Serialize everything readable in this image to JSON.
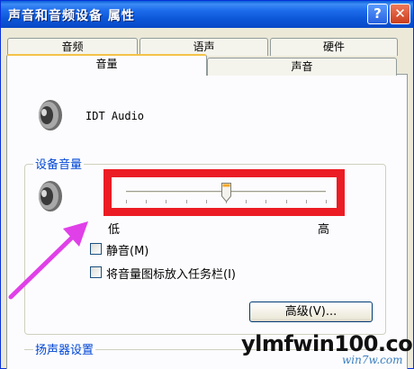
{
  "window": {
    "title": "声音和音频设备 属性",
    "help_label": "?",
    "close_label": "✕"
  },
  "tabs_back": [
    "音频",
    "语声",
    "硬件"
  ],
  "tabs_front": {
    "active": "音量",
    "other": "声音"
  },
  "device": {
    "name": "IDT Audio"
  },
  "volume_group": {
    "label": "设备音量",
    "low_label": "低",
    "high_label": "高",
    "level_fraction": 0.5
  },
  "options": {
    "mute_label": "静音(M)",
    "mute_checked": false,
    "tray_label": "将音量图标放入任务栏(I)",
    "tray_checked": false
  },
  "advanced_button": "高级(V)...",
  "speaker_group": {
    "label": "扬声器设置"
  },
  "watermark": {
    "main": "ylmfwin100.com",
    "sub": "win7w.com"
  },
  "colors": {
    "highlight": "#ec1c24",
    "arrow": "#e040e8",
    "title_bar": "#0a55d6"
  }
}
